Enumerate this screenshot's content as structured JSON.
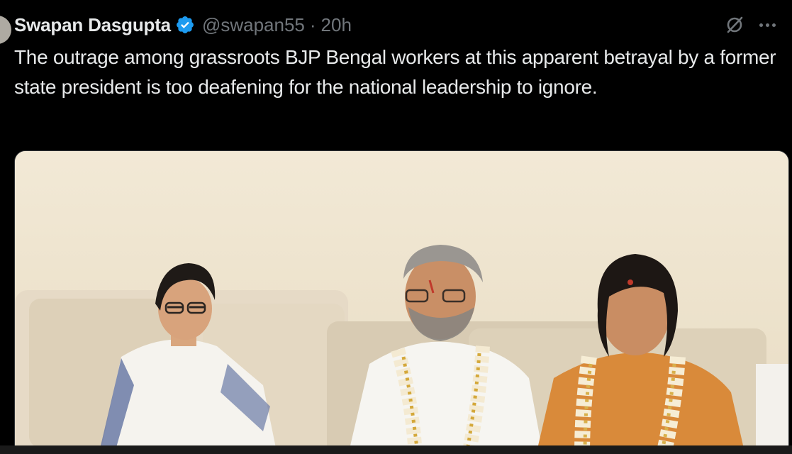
{
  "tweet": {
    "author": {
      "display_name": "Swapan Dasgupta",
      "handle": "@swapan55",
      "separator": "·",
      "time": "20h",
      "verified_icon": "verified-badge-icon"
    },
    "actions": {
      "grok_icon": "grok-icon",
      "more_icon": "more-options-icon"
    },
    "text": "The outrage among grassroots BJP Bengal workers at this apparent betrayal by a former state president is too deafening for the national leadership to ignore.",
    "media": {
      "type": "photo",
      "people_count": 3
    }
  },
  "colors": {
    "background": "#000000",
    "primary_text": "#e7e9ea",
    "secondary_text": "#71767b",
    "verified_blue": "#1d9bf0"
  }
}
